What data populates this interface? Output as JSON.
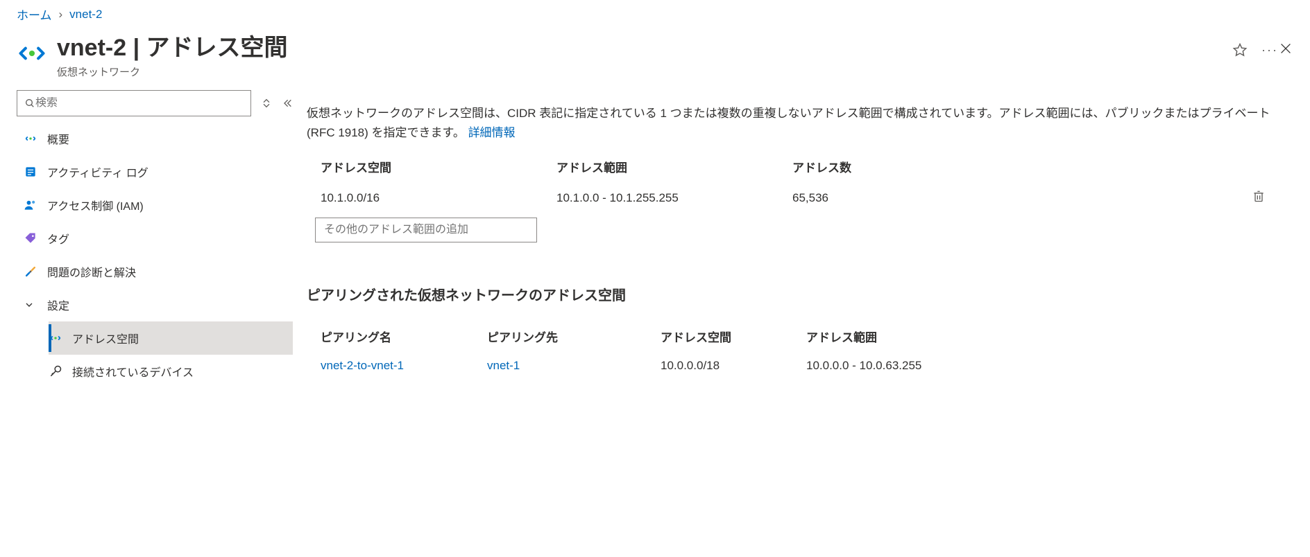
{
  "breadcrumb": {
    "home": "ホーム",
    "current": "vnet-2"
  },
  "header": {
    "title": "vnet-2 | アドレス空間",
    "subtitle": "仮想ネットワーク"
  },
  "sidebar": {
    "search_placeholder": "検索",
    "overview": "概要",
    "activity_log": "アクティビティ ログ",
    "access_control": "アクセス制御 (IAM)",
    "tags": "タグ",
    "diagnose": "問題の診断と解決",
    "settings": "設定",
    "address_space": "アドレス空間",
    "connected_devices": "接続されているデバイス"
  },
  "main": {
    "intro_text": "仮想ネットワークのアドレス空間は、CIDR 表記に指定されている 1 つまたは複数の重複しないアドレス範囲で構成されています。アドレス範囲には、パブリックまたはプライベート (RFC 1918) を指定できます。",
    "intro_link": "詳細情報",
    "addr_headers": {
      "space": "アドレス空間",
      "range": "アドレス範囲",
      "count": "アドレス数"
    },
    "addr_rows": [
      {
        "space": "10.1.0.0/16",
        "range": "10.1.0.0 - 10.1.255.255",
        "count": "65,536"
      }
    ],
    "add_placeholder": "その他のアドレス範囲の追加",
    "peered_heading": "ピアリングされた仮想ネットワークのアドレス空間",
    "peer_headers": {
      "name": "ピアリング名",
      "target": "ピアリング先",
      "space": "アドレス空間",
      "range": "アドレス範囲"
    },
    "peer_rows": [
      {
        "name": "vnet-2-to-vnet-1",
        "target": "vnet-1",
        "space": "10.0.0.0/18",
        "range": "10.0.0.0 - 10.0.63.255"
      }
    ]
  }
}
